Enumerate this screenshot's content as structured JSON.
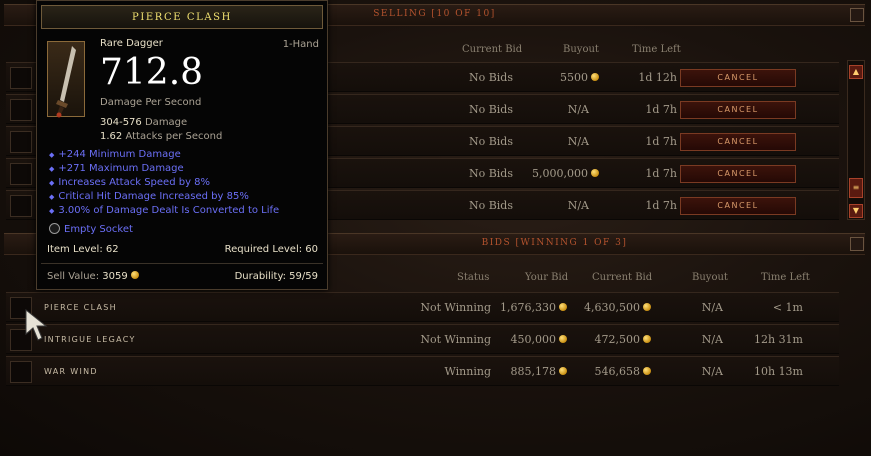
{
  "selling": {
    "title": "SELLING [10 OF 10]",
    "columns": {
      "current_bid": "Current Bid",
      "buyout": "Buyout",
      "time_left": "Time Left"
    },
    "rows": [
      {
        "current_bid": "No Bids",
        "buyout": "5500",
        "time_left": "1d 12h",
        "cancel": "CANCEL"
      },
      {
        "current_bid": "No Bids",
        "buyout": "N/A",
        "time_left": "1d 7h",
        "cancel": "CANCEL"
      },
      {
        "current_bid": "No Bids",
        "buyout": "N/A",
        "time_left": "1d 7h",
        "cancel": "CANCEL"
      },
      {
        "current_bid": "No Bids",
        "buyout": "5,000,000",
        "time_left": "1d 7h",
        "cancel": "CANCEL"
      },
      {
        "current_bid": "No Bids",
        "buyout": "N/A",
        "time_left": "1d 7h",
        "cancel": "CANCEL"
      }
    ]
  },
  "bids": {
    "title": "BIDS [WINNING 1 OF 3]",
    "columns": {
      "status": "Status",
      "your_bid": "Your Bid",
      "current_bid": "Current Bid",
      "buyout": "Buyout",
      "time_left": "Time Left"
    },
    "rows": [
      {
        "name": "PIERCE CLASH",
        "status": "Not Winning",
        "your_bid": "1,676,330",
        "current_bid": "4,630,500",
        "buyout": "N/A",
        "time_left": "< 1m"
      },
      {
        "name": "INTRIGUE LEGACY",
        "status": "Not Winning",
        "your_bid": "450,000",
        "current_bid": "472,500",
        "buyout": "N/A",
        "time_left": "12h 31m"
      },
      {
        "name": "WAR WIND",
        "status": "Winning",
        "your_bid": "885,178",
        "current_bid": "546,658",
        "buyout": "N/A",
        "time_left": "10h 13m"
      }
    ]
  },
  "tooltip": {
    "name": "PIERCE CLASH",
    "item_type": "Rare Dagger",
    "slot": "1-Hand",
    "dps": "712.8",
    "dps_label": "Damage Per Second",
    "damage_range": "304-576",
    "damage_label": "Damage",
    "attack_speed": "1.62",
    "attack_speed_label": "Attacks per Second",
    "affixes": [
      "+244 Minimum Damage",
      "+271 Maximum Damage",
      "Increases Attack Speed by 8%",
      "Critical Hit Damage Increased by 85%",
      "3.00% of Damage Dealt Is Converted to Life"
    ],
    "socket": "Empty Socket",
    "item_level": "Item Level: 62",
    "required_level": "Required Level: 60",
    "sell_value_label": "Sell Value:",
    "sell_value": "3059",
    "durability": "Durability: 59/59"
  },
  "colors": {
    "title_gold": "#f0e070",
    "magic_blue": "#6b6ff6",
    "section_title": "#b4532e",
    "cancel_text": "#d99a6a"
  },
  "icons": {
    "gold": "gold-coin-icon",
    "cursor": "cursor-pointer-icon",
    "scroll_up": "scroll-up-arrow-icon",
    "scroll_down": "scroll-down-arrow-icon",
    "socket": "empty-socket-icon",
    "weapon": "dagger-icon"
  }
}
